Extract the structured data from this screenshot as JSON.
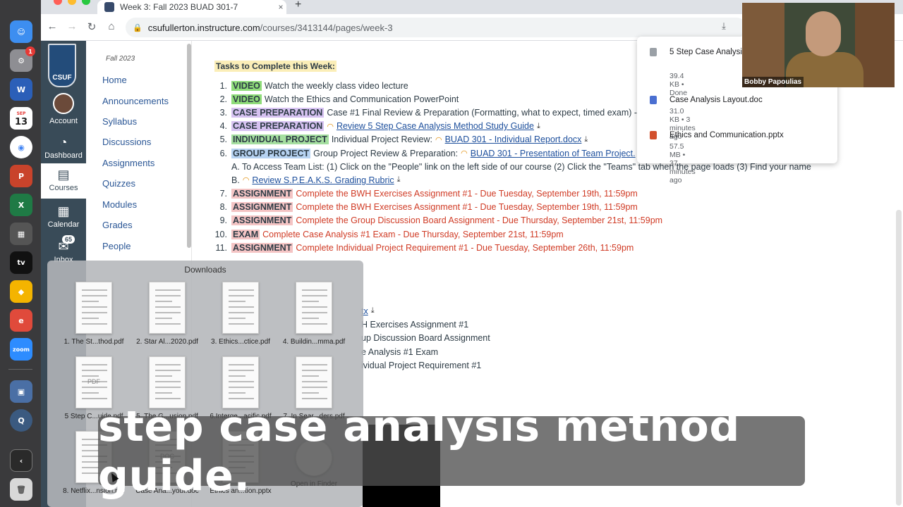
{
  "browser": {
    "tab_title": "Week 3: Fall 2023 BUAD 301-7",
    "tab_close": "×",
    "new_tab": "+",
    "back": "←",
    "forward": "→",
    "reload": "↻",
    "home": "⌂",
    "url_host": "csufullerton.instructure.com",
    "url_path": "/courses/3413144/pages/week-3"
  },
  "dock": {
    "apps": [
      "Finder",
      "Settings",
      "Word",
      "Calendar",
      "Chrome",
      "PowerPoint",
      "Excel",
      "Calculator",
      "Apple TV",
      "Sketch",
      "Express",
      "Zoom",
      "Preview",
      "QuickTime",
      "Collapse",
      "Trash"
    ],
    "calendar_day": "13",
    "calendar_month": "SEP",
    "settings_badge": "1",
    "zoom_label": "zoom",
    "tv_label": "tv"
  },
  "global_nav": {
    "logo": "CSUF",
    "items": [
      {
        "label": "Account",
        "icon": "account-icon"
      },
      {
        "label": "Dashboard",
        "icon": "dashboard-icon"
      },
      {
        "label": "Courses",
        "icon": "courses-icon"
      },
      {
        "label": "Calendar",
        "icon": "calendar-icon"
      },
      {
        "label": "Inbox",
        "icon": "inbox-icon",
        "badge": "65"
      }
    ]
  },
  "course_nav": {
    "term": "Fall 2023",
    "items": [
      "Home",
      "Announcements",
      "Syllabus",
      "Discussions",
      "Assignments",
      "Quizzes",
      "Modules",
      "Grades",
      "People"
    ]
  },
  "page": {
    "tasks_heading": "Tasks to Complete this Week:",
    "tasks": [
      {
        "n": "1.",
        "tag": "VIDEO",
        "text": "Watch the weekly class video lecture",
        "style": "plain"
      },
      {
        "n": "2.",
        "tag": "VIDEO",
        "text": "Watch the Ethics and Communication PowerPoint",
        "style": "plain"
      },
      {
        "n": "3.",
        "tag": "CASE PREPARATION",
        "text": "Case #1 Final Review & Preparation (Formatting, what to expect, timed exam) -",
        "link": "C",
        "style": "plain"
      },
      {
        "n": "4.",
        "tag": "CASE PREPARATION",
        "link": "Review 5 Step Case Analysis Method Study Guide",
        "style": "link"
      },
      {
        "n": "5.",
        "tag": "INDIVIDUAL PROJECT",
        "text": "Individual Project Review:",
        "link": "BUAD 301 - Individual Report.docx",
        "style": "link"
      },
      {
        "n": "6.",
        "tag": "GROUP PROJECT",
        "text": "Group Project Review & Preparation:",
        "link": "BUAD 301 - Presentation of Team Project.",
        "style": "link"
      },
      {
        "n": "",
        "tag": "",
        "text": "A. To Access Team List: (1) Click on the \"People\" link on the left side of our course (2) Click the \"Teams\" tab when the page loads (3) Find your name",
        "style": "sub"
      },
      {
        "n": "",
        "tag": "",
        "text": "B.",
        "link": "Review S.P.E.A.K.S. Grading Rubric",
        "style": "sub"
      },
      {
        "n": "7.",
        "tag": "ASSIGNMENT",
        "text": "Complete the BWH Exercises Assignment #1 - Due Tuesday, September 19th, 11:59pm",
        "style": "red"
      },
      {
        "n": "8.",
        "tag": "ASSIGNMENT",
        "text": "Complete the BWH Exercises Assignment #1 - Due Tuesday, September 19th, 11:59pm",
        "style": "red"
      },
      {
        "n": "9.",
        "tag": "ASSIGNMENT",
        "text": "Complete the Group Discussion Board Assignment - Due Thursday, September 21st, 11:59pm",
        "style": "red"
      },
      {
        "n": "10.",
        "tag": "EXAM",
        "text": "Complete Case Analysis #1 Exam - Due Thursday, September 21st, 11:59pm",
        "style": "red"
      },
      {
        "n": "11.",
        "tag": "ASSIGNMENT",
        "text": "Complete Individual Project Requirement #1 - Due Tuesday, September 26th, 11:59pm",
        "style": "red"
      }
    ],
    "second_list": [
      {
        "link": "tx",
        "text": ""
      },
      {
        "link": "",
        "text": "H Exercises Assignment #1"
      },
      {
        "link": "",
        "text": "up Discussion Board Assignment"
      },
      {
        "link": "",
        "text": "e Analysis #1 Exam"
      },
      {
        "link": "",
        "text": "ividual Project Requirement #1"
      }
    ]
  },
  "downloads_bubble": {
    "items": [
      {
        "name": "5 Step Case Analysis Guide.pdf",
        "meta": "39.4 KB • Done",
        "color": "#9aa0a6"
      },
      {
        "name": "Case Analysis Layout.doc",
        "meta": "31.0 KB • 3 minutes ago",
        "color": "#4a6fd1"
      },
      {
        "name": "Ethics and Communication.pptx",
        "meta": "57.5 MB • 37 minutes ago",
        "color": "#d2502d"
      }
    ]
  },
  "webcam": {
    "name": "Bobby Papoulias"
  },
  "downloads_stack": {
    "title": "Downloads",
    "files": [
      {
        "label": "1. The St...thod.pdf",
        "thumb": ""
      },
      {
        "label": "2. Star Al...2020.pdf",
        "thumb": ""
      },
      {
        "label": "3. Ethics...ctice.pdf",
        "thumb": ""
      },
      {
        "label": "4. Buildin...mma.pdf",
        "thumb": ""
      },
      {
        "label": "5 Step C...uide.pdf",
        "thumb": "PDF"
      },
      {
        "label": "5. The G...usion.pdf",
        "thumb": ""
      },
      {
        "label": "6.Interge...acific.pdf",
        "thumb": ""
      },
      {
        "label": "7. In Sear...ders.pdf",
        "thumb": ""
      },
      {
        "label": "8. Netflix...nsion.pdf",
        "thumb": ""
      },
      {
        "label": "Case Ana...yout.doc",
        "thumb": "DOC"
      },
      {
        "label": "Ethics an...tion.pptx",
        "thumb": ""
      },
      {
        "label": "Open in Finder",
        "thumb": ""
      }
    ]
  },
  "caption": "step case analysis method guide."
}
